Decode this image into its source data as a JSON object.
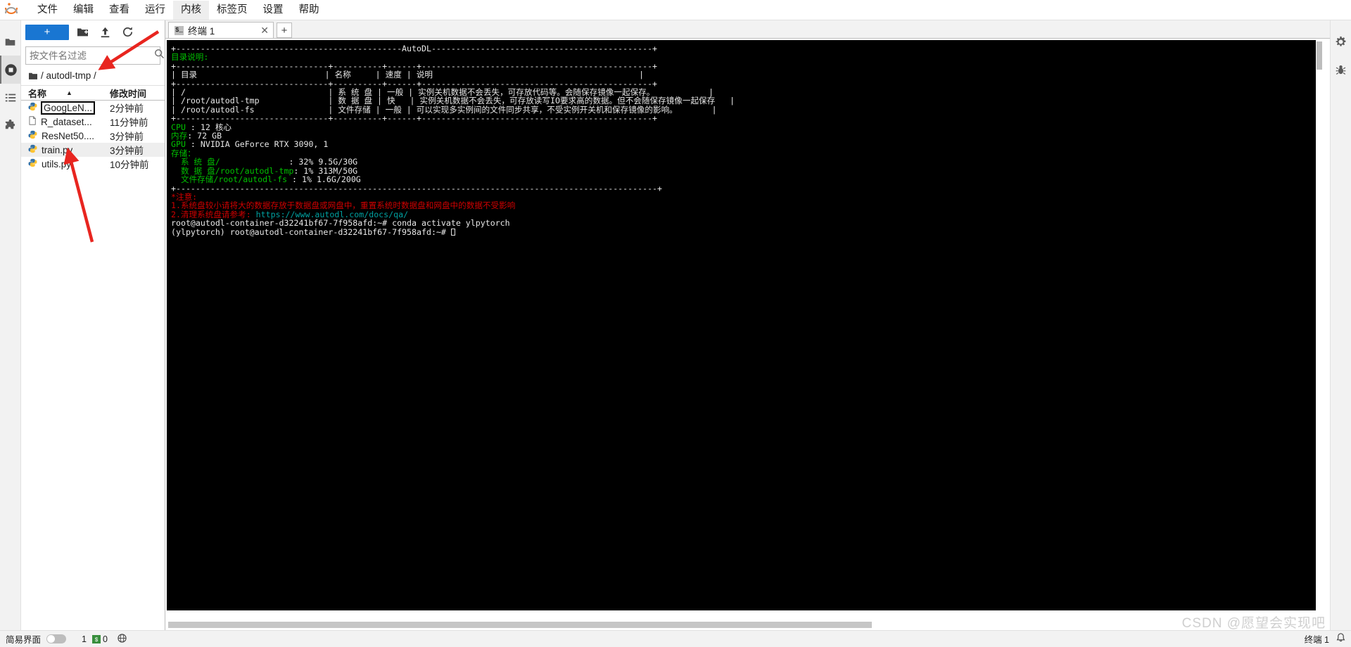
{
  "app": {
    "menu": [
      {
        "label": "文件",
        "active": false
      },
      {
        "label": "编辑",
        "active": false
      },
      {
        "label": "查看",
        "active": false
      },
      {
        "label": "运行",
        "active": false
      },
      {
        "label": "内核",
        "active": true
      },
      {
        "label": "标签页",
        "active": false
      },
      {
        "label": "设置",
        "active": false
      },
      {
        "label": "帮助",
        "active": false
      }
    ],
    "logo_name": "jupyter-logo"
  },
  "activitybar": {
    "items": [
      {
        "name": "file-browser-icon",
        "glyph": "folder",
        "selected": false
      },
      {
        "name": "running-terminals-icon",
        "glyph": "stop-circle",
        "selected": true
      },
      {
        "name": "commands-icon",
        "glyph": "list",
        "selected": false
      },
      {
        "name": "extensions-icon",
        "glyph": "puzzle",
        "selected": false
      }
    ]
  },
  "filebrowser": {
    "new_button": "+",
    "toolbar_buttons": [
      {
        "name": "new-folder-button",
        "title": "新建文件夹"
      },
      {
        "name": "upload-button",
        "title": "上传"
      },
      {
        "name": "refresh-button",
        "title": "刷新"
      }
    ],
    "filter_placeholder": "按文件名过滤",
    "filter_value": "",
    "breadcrumb": "/ autodl-tmp /",
    "columns": {
      "name": "名称",
      "modified": "修改时间"
    },
    "sort_indicator": "▲",
    "files": [
      {
        "name": "GoogLeN...",
        "modified": "2分钟前",
        "type": "python",
        "selected": false,
        "boxed": true
      },
      {
        "name": "R_dataset...",
        "modified": "11分钟前",
        "type": "file",
        "selected": false,
        "boxed": false
      },
      {
        "name": "ResNet50....",
        "modified": "3分钟前",
        "type": "python",
        "selected": false,
        "boxed": false
      },
      {
        "name": "train.py",
        "modified": "3分钟前",
        "type": "python",
        "selected": true,
        "boxed": false
      },
      {
        "name": "utils.py",
        "modified": "10分钟前",
        "type": "python",
        "selected": false,
        "boxed": false
      }
    ]
  },
  "tabbar": {
    "tabs": [
      {
        "label": "终端 1",
        "icon": "terminal-icon",
        "close": "✕",
        "active": true
      }
    ],
    "add_label": "+"
  },
  "terminal": {
    "lines": [
      {
        "color": "white",
        "text": "+----------------------------------------------AutoDL---------------------------------------------+"
      },
      {
        "color": "green",
        "text": "目录说明:"
      },
      {
        "color": "white",
        "text": "+-------------------------------+----------+------+-----------------------------------------------+"
      },
      {
        "color": "white",
        "text": "| 目录                          | 名称     | 速度 | 说明                                          |"
      },
      {
        "color": "white",
        "text": "+-------------------------------+----------+------+-----------------------------------------------+"
      },
      {
        "color": "white",
        "text": "| /                             | 系 统 盘 | 一般 | 实例关机数据不会丢失，可存放代码等。会随保存镜像一起保存。           |"
      },
      {
        "color": "white",
        "text": "| /root/autodl-tmp              | 数 据 盘 | 快   | 实例关机数据不会丢失，可存放读写IO要求高的数据。但不会随保存镜像一起保存   |"
      },
      {
        "color": "white",
        "text": "| /root/autodl-fs               | 文件存储 | 一般 | 可以实现多实例间的文件同步共享，不受实例开关机和保存镜像的影响。       |"
      },
      {
        "color": "white",
        "text": "+-------------------------------+----------+------+-----------------------------------------------+"
      }
    ],
    "specs": [
      {
        "label": "CPU ",
        "sep": ": ",
        "value": "12 核心"
      },
      {
        "label": "内存",
        "sep": ": ",
        "value": "72 GB"
      },
      {
        "label": "GPU ",
        "sep": ": ",
        "value": "NVIDIA GeForce RTX 3090, 1"
      }
    ],
    "storage_label": "存储：",
    "storage": [
      {
        "name": "系 统 盘",
        "path": "/",
        "pad": "              ",
        "sep": ": ",
        "value": "32% 9.5G/30G"
      },
      {
        "name": "数 据 盘",
        "path": "/root/autodl-tmp",
        "pad": "",
        "sep": ": ",
        "value": "1% 313M/50G"
      },
      {
        "name": "文件存储",
        "path": "/root/autodl-fs",
        "pad": " ",
        "sep": ": ",
        "value": "1% 1.6G/200G"
      }
    ],
    "divider": "+--------------------------------------------------------------------------------------------------+",
    "notice_title": "*注意:",
    "notices": [
      {
        "text": "1.系统盘较小请将大的数据存放于数据盘或网盘中，重置系统时数据盘和网盘中的数据不受影响",
        "link": ""
      },
      {
        "text": "2.清理系统盘请参考: ",
        "link": "https://www.autodl.com/docs/qa/"
      }
    ],
    "prompts": [
      {
        "prefix": "root@autodl-container-d32241bf67-7f958afd:~# ",
        "command": "conda activate ylpytorch",
        "cursor": false
      },
      {
        "prefix": "(ylpytorch) root@autodl-container-d32241bf67-7f958afd:~# ",
        "command": "",
        "cursor": true
      }
    ]
  },
  "rightbar": {
    "items": [
      {
        "name": "property-inspector-icon",
        "glyph": "gear"
      },
      {
        "name": "debugger-icon",
        "glyph": "bug"
      }
    ]
  },
  "statusbar": {
    "simple_label": "简易界面",
    "simple_enabled": false,
    "terminal_count": "1",
    "kernel_count": "0",
    "globe_name": "globe-icon",
    "right_label": "终端 1",
    "notification_name": "notification-bell-icon"
  },
  "watermark": "CSDN @愿望会实现吧",
  "annotations": {
    "arrows": [
      {
        "name": "arrow-to-filter-input",
        "color": "#e8251f"
      },
      {
        "name": "arrow-to-train-py",
        "color": "#e8251f"
      }
    ]
  },
  "colors": {
    "accent": "#1976d2",
    "terminal_bg": "#000000",
    "terminal_green": "#00c000",
    "terminal_red": "#d00000",
    "terminal_cyan": "#00a0a0",
    "arrow_red": "#e8251f"
  }
}
